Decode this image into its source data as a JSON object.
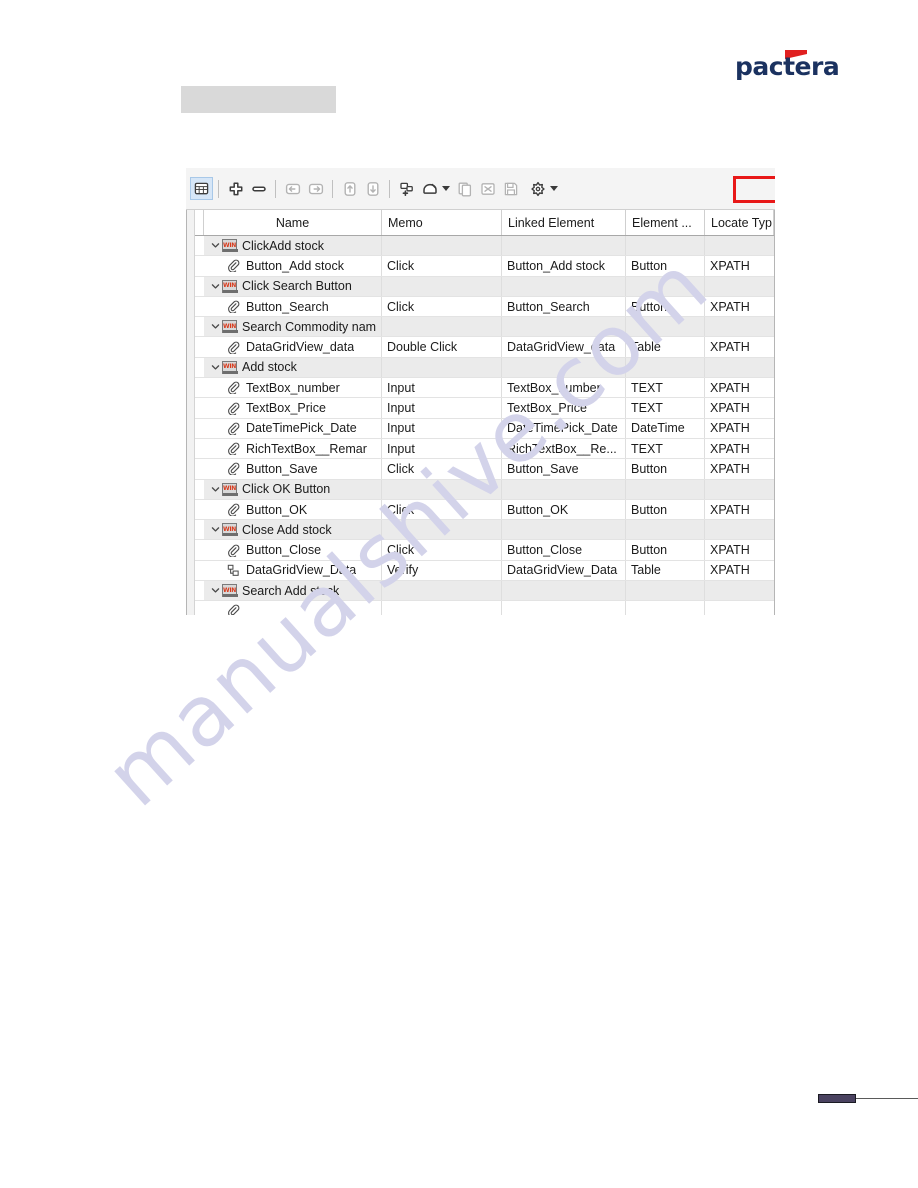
{
  "logo": {
    "text": "pactera",
    "flag_color": "#e02020",
    "text_color": "#1b3260",
    "name": "pactera-logo"
  },
  "placeholder": {
    "label": "",
    "color": "#d9d9d9"
  },
  "watermark": {
    "text": "manualshive.com",
    "color": "#d3d3ea"
  },
  "toolbar": {
    "highlight_color": "#e81818",
    "buttons": [
      {
        "name": "grid-view-icon",
        "glyph": "grid",
        "active": true,
        "enabled": true
      },
      {
        "name": "add-row-icon",
        "glyph": "plus-cross",
        "active": false,
        "enabled": true
      },
      {
        "name": "remove-row-icon",
        "glyph": "minus-pill",
        "active": false,
        "enabled": true
      },
      {
        "name": "outdent-icon",
        "glyph": "arrow-left-box",
        "active": false,
        "enabled": false
      },
      {
        "name": "indent-icon",
        "glyph": "arrow-right-box",
        "active": false,
        "enabled": false
      },
      {
        "name": "move-up-icon",
        "glyph": "arrow-up-box",
        "active": false,
        "enabled": false
      },
      {
        "name": "move-down-icon",
        "glyph": "arrow-down-box",
        "active": false,
        "enabled": false
      },
      {
        "name": "add-element-icon",
        "glyph": "element-plus",
        "active": false,
        "enabled": true
      },
      {
        "name": "record-icon",
        "glyph": "record-blob",
        "active": false,
        "enabled": true
      },
      {
        "name": "copy-icon",
        "glyph": "copy-pages",
        "active": false,
        "enabled": false
      },
      {
        "name": "delete-icon",
        "glyph": "x-box",
        "active": false,
        "enabled": false
      },
      {
        "name": "save-icon",
        "glyph": "floppy",
        "active": false,
        "enabled": false
      },
      {
        "name": "plugin-settings-icon",
        "glyph": "puzzle",
        "active": false,
        "enabled": true
      }
    ]
  },
  "grid": {
    "columns": [
      {
        "key": "name",
        "label": "Name"
      },
      {
        "key": "memo",
        "label": "Memo"
      },
      {
        "key": "link",
        "label": "Linked Element"
      },
      {
        "key": "elem",
        "label": "Element ..."
      },
      {
        "key": "loc",
        "label": "Locate Typ"
      }
    ],
    "rows": [
      {
        "type": "group",
        "icon": "win-icon",
        "name": "ClickAdd stock",
        "memo": "",
        "link": "",
        "elem": "",
        "loc": ""
      },
      {
        "type": "child",
        "icon": "clip-icon",
        "name": "Button_Add stock",
        "memo": "Click",
        "link": "Button_Add stock",
        "elem": "Button",
        "loc": "XPATH"
      },
      {
        "type": "group",
        "icon": "win-icon",
        "name": "Click Search Button",
        "memo": "",
        "link": "",
        "elem": "",
        "loc": ""
      },
      {
        "type": "child",
        "icon": "clip-icon",
        "name": "Button_Search",
        "memo": "Click",
        "link": "Button_Search",
        "elem": "Button",
        "loc": "XPATH"
      },
      {
        "type": "group",
        "icon": "win-icon",
        "name": "Search Commodity nam",
        "memo": "",
        "link": "",
        "elem": "",
        "loc": ""
      },
      {
        "type": "child",
        "icon": "clip-icon",
        "name": "DataGridView_data",
        "memo": "Double Click",
        "link": "DataGridView_data",
        "elem": "Table",
        "loc": "XPATH"
      },
      {
        "type": "group",
        "icon": "win-icon",
        "name": "Add stock",
        "memo": "",
        "link": "",
        "elem": "",
        "loc": ""
      },
      {
        "type": "child",
        "icon": "clip-icon",
        "name": "TextBox_number",
        "memo": "Input",
        "link": "TextBox_number",
        "elem": "TEXT",
        "loc": "XPATH"
      },
      {
        "type": "child",
        "icon": "clip-icon",
        "name": "TextBox_Price",
        "memo": "Input",
        "link": "TextBox_Price",
        "elem": "TEXT",
        "loc": "XPATH"
      },
      {
        "type": "child",
        "icon": "clip-icon",
        "name": "DateTimePick_Date",
        "memo": "Input",
        "link": "DateTimePick_Date",
        "elem": "DateTime",
        "loc": "XPATH"
      },
      {
        "type": "child",
        "icon": "clip-icon",
        "name": "RichTextBox__Remar",
        "memo": "Input",
        "link": "RichTextBox__Re...",
        "elem": "TEXT",
        "loc": "XPATH"
      },
      {
        "type": "child",
        "icon": "clip-icon",
        "name": "Button_Save",
        "memo": "Click",
        "link": "Button_Save",
        "elem": "Button",
        "loc": "XPATH"
      },
      {
        "type": "group",
        "icon": "win-icon",
        "name": "Click OK Button",
        "memo": "",
        "link": "",
        "elem": "",
        "loc": ""
      },
      {
        "type": "child",
        "icon": "clip-icon",
        "name": "Button_OK",
        "memo": "Click",
        "link": "Button_OK",
        "elem": "Button",
        "loc": "XPATH"
      },
      {
        "type": "group",
        "icon": "win-icon",
        "name": "Close Add stock",
        "memo": "",
        "link": "",
        "elem": "",
        "loc": ""
      },
      {
        "type": "child",
        "icon": "clip-icon",
        "name": "Button_Close",
        "memo": "Click",
        "link": "Button_Close",
        "elem": "Button",
        "loc": "XPATH"
      },
      {
        "type": "child",
        "icon": "verify-icon",
        "name": "DataGridView_Data",
        "memo": "Verify",
        "link": "DataGridView_Data",
        "elem": "Table",
        "loc": "XPATH"
      },
      {
        "type": "group",
        "icon": "win-icon",
        "name": "Search Add stock",
        "memo": "",
        "link": "",
        "elem": "",
        "loc": ""
      },
      {
        "type": "child",
        "icon": "clip-icon",
        "name": "",
        "memo": "",
        "link": "",
        "elem": "",
        "loc": ""
      }
    ]
  }
}
